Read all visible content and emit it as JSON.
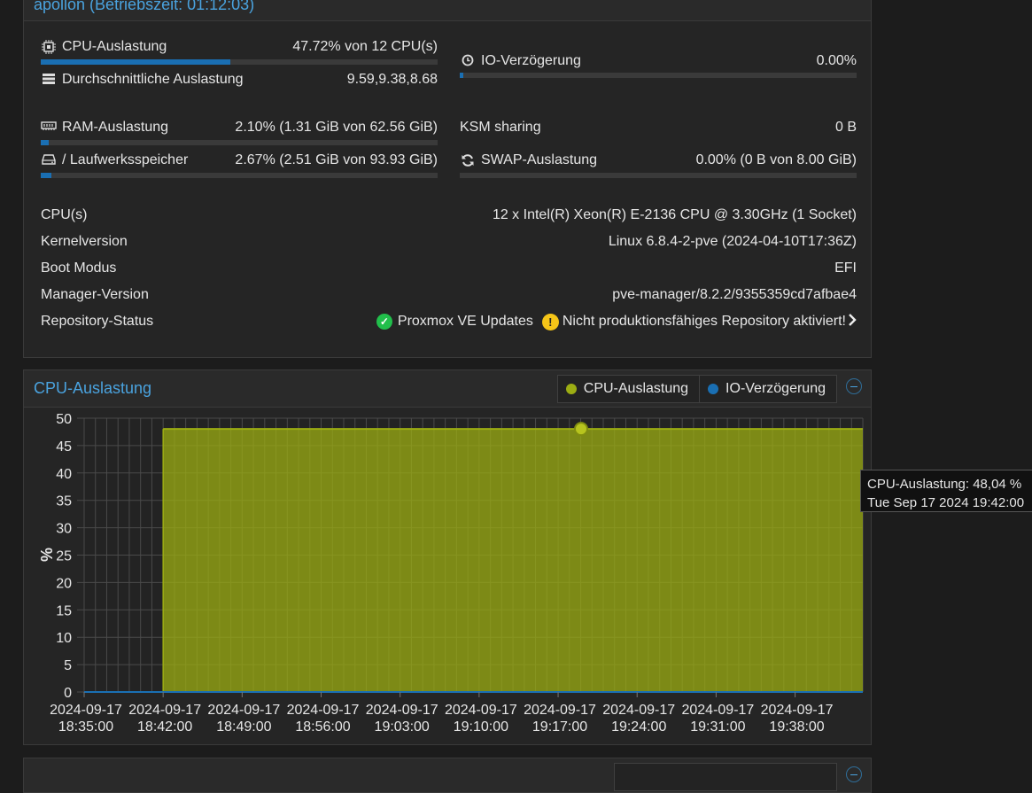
{
  "status": {
    "title": "apollon (Betriebszeit: 01:12:03)",
    "cpu": {
      "label": "CPU-Auslastung",
      "value": "47.72% von 12 CPU(s)",
      "fraction": 0.4772
    },
    "load": {
      "label": "Durchschnittliche Auslastung",
      "value": "9.59,9.38,8.68"
    },
    "io": {
      "label": "IO-Verzögerung",
      "value": "0.00%",
      "fraction": 0.0
    },
    "ram": {
      "label": "RAM-Auslastung",
      "value": "2.10% (1.31 GiB von 62.56 GiB)",
      "fraction": 0.021
    },
    "ksm": {
      "label": "KSM sharing",
      "value": "0 B"
    },
    "disk": {
      "label": "/ Laufwerksspeicher",
      "value": "2.67% (2.51 GiB von 93.93 GiB)",
      "fraction": 0.0267
    },
    "swap": {
      "label": "SWAP-Auslastung",
      "value": "0.00% (0 B von 8.00 GiB)",
      "fraction": 0.0
    },
    "info": [
      {
        "key": "CPU(s)",
        "value": "12 x Intel(R) Xeon(R) E-2136 CPU @ 3.30GHz (1 Socket)"
      },
      {
        "key": "Kernelversion",
        "value": "Linux 6.8.4-2-pve (2024-04-10T17:36Z)"
      },
      {
        "key": "Boot Modus",
        "value": "EFI"
      },
      {
        "key": "Manager-Version",
        "value": "pve-manager/8.2.2/9355359cd7afbae4"
      }
    ],
    "repo": {
      "key": "Repository-Status",
      "ok_text": "Proxmox VE Updates",
      "warn_text": "Nicht produktionsfähiges Repository aktiviert!"
    }
  },
  "cpu_panel": {
    "title": "CPU-Auslastung",
    "legend": [
      {
        "label": "CPU-Auslastung",
        "color": "#9cad13"
      },
      {
        "label": "IO-Verzögerung",
        "color": "#1a6fb3"
      }
    ]
  },
  "tooltip": {
    "line1": "CPU-Auslastung: 48,04 %",
    "line2": "Tue Sep 17 2024 19:42:00"
  },
  "chart_data": {
    "type": "area",
    "ylabel": "%",
    "ylim": [
      0,
      50
    ],
    "yticks": [
      0,
      5,
      10,
      15,
      20,
      25,
      30,
      35,
      40,
      45,
      50
    ],
    "xticks": [
      {
        "date": "2024-09-17",
        "time": "18:35:00"
      },
      {
        "date": "2024-09-17",
        "time": "18:42:00"
      },
      {
        "date": "2024-09-17",
        "time": "18:49:00"
      },
      {
        "date": "2024-09-17",
        "time": "18:56:00"
      },
      {
        "date": "2024-09-17",
        "time": "19:03:00"
      },
      {
        "date": "2024-09-17",
        "time": "19:10:00"
      },
      {
        "date": "2024-09-17",
        "time": "19:17:00"
      },
      {
        "date": "2024-09-17",
        "time": "19:24:00"
      },
      {
        "date": "2024-09-17",
        "time": "19:31:00"
      },
      {
        "date": "2024-09-17",
        "time": "19:38:00"
      }
    ],
    "xrange": [
      "2024-09-17 18:35:00",
      "2024-09-17 19:44:00"
    ],
    "series": [
      {
        "name": "CPU-Auslastung",
        "color": "#9cad13",
        "start": "2024-09-17 18:42:00",
        "end": "2024-09-17 19:44:00",
        "value": 48.04
      },
      {
        "name": "IO-Verzögerung",
        "color": "#1a6fb3",
        "start": "2024-09-17 18:35:00",
        "end": "2024-09-17 19:44:00",
        "value": 0
      }
    ],
    "highlight": {
      "series": "CPU-Auslastung",
      "x": "2024-09-17 19:42:00",
      "y": 48.04
    },
    "grid": true
  }
}
